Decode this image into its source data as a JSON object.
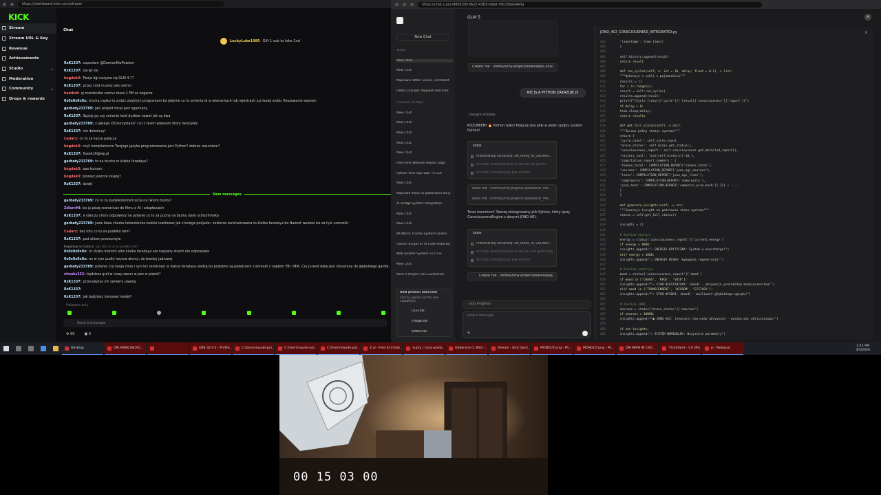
{
  "kick": {
    "url": "https://dashboard.kick.com/stream",
    "logo": "KICK",
    "nav": [
      {
        "label": "Stream",
        "active": true,
        "chevron": false
      },
      {
        "label": "Stream URL & Key",
        "active": false,
        "chevron": false
      },
      {
        "label": "Revenue",
        "active": false,
        "chevron": false
      },
      {
        "label": "Achievements",
        "active": false,
        "chevron": false
      },
      {
        "label": "Studio",
        "active": false,
        "chevron": true
      },
      {
        "label": "Moderation",
        "active": false,
        "chevron": false
      },
      {
        "label": "Community",
        "active": false,
        "chevron": true
      },
      {
        "label": "Drops & rewards",
        "active": false,
        "chevron": false
      }
    ],
    "chat_title": "Chat",
    "pinned_user": "LuckyLuke1980",
    "pinned_text": "Gift 1 sub to take 2nd",
    "messages": [
      {
        "user": "RzK1337:",
        "color": "#bfe4ff",
        "text": "zapoolem @DamianNiePowiem"
      },
      {
        "user": "RzK1337:",
        "color": "#bfe4ff",
        "text": "zacięł sie"
      },
      {
        "user": "bogdek3:",
        "color": "#ff6b6b",
        "text": "Twoja Agi nazywa się GLM 4.7?"
      },
      {
        "user": "RzK1337:",
        "color": "#bfe4ff",
        "text": "przez cmd musisz jako admin"
      },
      {
        "user": "hambot:",
        "color": "#ff6b6b",
        "text": "ej mordeczko czemu masz 2 PM za zegarze"
      },
      {
        "user": "0x0x0x0x0x:",
        "color": "#bfe4ff",
        "text": "trochę ciężko to zrobić zwykłym programem bo jedynie co to zmienia id w elementach lub rejestrach juz lepiej zrobic fleszowanie eeprom"
      },
      {
        "user": "garbaty213769:",
        "color": "#bfe4ff",
        "text": "jaki projekt teraz jest ogarniany"
      },
      {
        "user": "RzK1337:",
        "color": "#bfe4ff",
        "text": "Spytaj go czy zmienia heid dysków nawet jak są dwa"
      },
      {
        "user": "garbaty213769:",
        "color": "#bfe4ff",
        "text": "z jakiego OS korzystasz? i co z tesim własnym który tworzyłeś"
      },
      {
        "user": "RzK1337:",
        "color": "#bfe4ff",
        "text": "nie dokończy!"
      },
      {
        "user": "Cadarz:",
        "color": "#ff6b6b",
        "text": "co to za kasza palacza"
      },
      {
        "user": "bogdek3:",
        "color": "#ff6b6b",
        "text": "czyli kompilatorem Twojego języka programowania jest Python? dobrze rozumiem?"
      },
      {
        "user": "RzK1337:",
        "color": "#bfe4ff",
        "text": "fiseek16@wp.pl"
      },
      {
        "user": "garbaty213769:",
        "color": "#bfe4ff",
        "text": "to na biurku to klatka faradaya?"
      },
      {
        "user": "bogdek3:",
        "color": "#ff6b6b",
        "text": "aaa kumam"
      },
      {
        "user": "bogdek3:",
        "color": "#ff6b6b",
        "text": "piszesz jeszcze książę?"
      },
      {
        "user": "RzK1337:",
        "color": "#bfe4ff",
        "text": "dzięki"
      },
      {
        "user": "garbaty213769:",
        "color": "#bfe4ff",
        "text": "co to za pudełko/konstrukcja na twoim biurku?"
      },
      {
        "user": "ZdlanrNi:",
        "color": "#c58cff",
        "text": "bo ja piszę scenariusz do filmu o AI i adaptacjach"
      },
      {
        "user": "RzK1337:",
        "color": "#bfe4ff",
        "text": "a starczu chory odpowiesz na pytanie co to za pucha na biurku obok schizofrenika"
      },
      {
        "user": "garbaty213769:",
        "color": "#bfe4ff",
        "text": "juwe biała charka holenderska bedzie lewitowac jak z kolega podjade i zostanie zarekwirowana ta klatka faradaya bo Nawrot wezwał sie za tylo uszczelki"
      },
      {
        "user": "Cadarz:",
        "color": "#ff6b6b",
        "text": "bez kitu co to za pudełko tam?"
      },
      {
        "user": "RzK1337:",
        "color": "#bfe4ff",
        "text": "pod okiem przesunięte"
      },
      {
        "user": "Replying to Cadarz:",
        "color": "#777",
        "text": "bez kitu co to za pudełko tam?"
      },
      {
        "user": "0x0x0x0x0x:",
        "color": "#bfe4ff",
        "text": "to chyba monolit albo klatka faradaya ale nacpany starch nie odpowiada"
      },
      {
        "user": "0x0x0x0x0x:",
        "color": "#bfe4ff",
        "text": "on w tym pudle trzyma atomy, do bomby jadrowej"
      },
      {
        "user": "garbaty213769:",
        "color": "#bfe4ff",
        "text": "pytanie czy twoja żona i syn też zamknięci w klatce faradaya siedzą bo podobno są podejrzani o kontakt z rządem FBI i MI6. Czy jurand dalej jest zmuszony do głębokiego gardła?"
      },
      {
        "user": "olmaks232:",
        "color": "#c58cff",
        "text": "będziesz grał w nowy sezon w poe w piątek?"
      },
      {
        "user": "RzK1337:",
        "color": "#bfe4ff",
        "text": "przecialyżas ich serwery uważaj"
      },
      {
        "user": "RzK1337:",
        "color": "#bfe4ff",
        "text": ""
      },
      {
        "user": "RzK1337:",
        "color": "#bfe4ff",
        "text": "jak będziesz trenował model?"
      }
    ],
    "new_messages_label": "New messages",
    "followers_only": "Followers only",
    "send_placeholder": "Send a message",
    "bottom_left": "00",
    "bottom_right": "0"
  },
  "zai": {
    "url": "https://chat.z.ai/c/96622df-0622-4381-bda0-78cd3beb4e0a",
    "model": "GLM 5",
    "new_chat": "New Chat",
    "history": [
      {
        "label": "Today",
        "head": true
      },
      {
        "label": "New Chat",
        "sel": true
      },
      {
        "label": "New Chat"
      },
      {
        "label": "Naprawa HWID: Scena i Architekt"
      },
      {
        "label": "HWID Changer Request Declined"
      },
      {
        "label": "Previous 30 days",
        "head": true
      },
      {
        "label": "New Chat"
      },
      {
        "label": "New Chat"
      },
      {
        "label": "New Chat"
      },
      {
        "label": "New Chat"
      },
      {
        "label": "New Chat"
      },
      {
        "label": "Real-time Website Repair Logic"
      },
      {
        "label": "Python OCR App with Tk GUI"
      },
      {
        "label": "New Chat"
      },
      {
        "label": "Naprawa błędu w pobieraniu okny"
      },
      {
        "label": "AI Bridge System Integration"
      },
      {
        "label": "New Chat"
      },
      {
        "label": "New Chat"
      },
      {
        "label": "MONOLIT Fractal System Global"
      },
      {
        "label": "Python Script for AI Code Refactor"
      },
      {
        "label": "Web Builder System v1.0 Fix"
      },
      {
        "label": "New Chat"
      },
      {
        "label": "Nech z Project Gen Guidelines"
      }
    ],
    "promo_title": "New product launched",
    "promo_text": "Click to explore and try new capabilities",
    "promo_items": [
      "OCR.zai",
      "image.zai",
      "slides.zai"
    ],
    "user_message": "NIE JS A PYTHON ZAKAZUJE JS",
    "thought": "Thought Process",
    "reply1": "ROZUMIEM! 🔥 Python tylko! Połączę oba pliki w jeden spójny system Python!",
    "todos_label": "Todos",
    "todos1": [
      "Przeanalizuj strukturę OM_MAIN_IN_CROWN...",
      "Wczytaj wszystkie pliki JONO AGI w govmi...",
      "Wczytaj integracyjny plik Python"
    ],
    "read_file1": "Read File · /home/z/my-project/upload/OM_MA...",
    "read_file2": "Read File · /home/z/my-project/upload/OM_MA...",
    "reply2": "Teraz rozumiem! Tworzę zintegrowany plik Python, który łączy ConsciousnessEngine z danymi JONO AGI:",
    "todos2": [
      "Przeanalizuj strukturę OM_MAIN_IN_CROWN...",
      "Wczytaj wszystkie pliki JONO AGI do głównego...",
      "Wczytaj integracyjny plik Python"
    ],
    "create_file_top": "Create File · /home/z/my-project/download/Consc...",
    "create_file": "Create File · /home/z/my-project/download/JO...",
    "todo_progress": "Todo Progress",
    "input_placeholder": "Send a Message",
    "code_file": "JONO_AGI_CONSCIOUSNESS_INTEGRATED.py",
    "code_lines": [
      {
        "n": "602",
        "t": "            'timestamp': time.time()"
      },
      {
        "n": "603",
        "t": "        }"
      },
      {
        "n": "604",
        "t": ""
      },
      {
        "n": "605",
        "t": "        self.history.append(result)"
      },
      {
        "n": "606",
        "t": "        return result"
      },
      {
        "n": "607",
        "t": ""
      },
      {
        "n": "608",
        "t": "    def run_cycles(self, n: int = 10, delay: float = 0.1) -> list:"
      },
      {
        "n": "609",
        "t": "        \"\"\"Wykonuje n cykli z pojemnościa\"\"\""
      },
      {
        "n": "610",
        "t": "        results = []"
      },
      {
        "n": "611",
        "t": "        for i in range(n):"
      },
      {
        "n": "612",
        "t": "            result = self.run_cycle()"
      },
      {
        "n": "613",
        "t": "            results.append(result)"
      },
      {
        "n": "614",
        "t": "            print(f\"[Cycle {result['cycle']}] {result['consciousness']['report']}\")"
      },
      {
        "n": "615",
        "t": "            if delay > 0:"
      },
      {
        "n": "616",
        "t": "                time.sleep(delay)"
      },
      {
        "n": "617",
        "t": "        return results"
      },
      {
        "n": "618",
        "t": ""
      },
      {
        "n": "619",
        "t": "    def get_full_status(self) -> dict:"
      },
      {
        "n": "620",
        "t": "        \"\"\"Zwraca pełny status systemu\"\"\""
      },
      {
        "n": "621",
        "t": "        return {"
      },
      {
        "n": "622",
        "t": "            'cycle_count': self.cycle_count,"
      },
      {
        "n": "623",
        "t": "            'brain_status': self.brain.get_status(),"
      },
      {
        "n": "624",
        "t": "            'consciousness_report': self.consciousness.get_detailed_report(),"
      },
      {
        "n": "625",
        "t": "            'history_tail': list(self.history)[-10:],"
      },
      {
        "n": "626",
        "t": "            'compilation_report_summary': {"
      },
      {
        "n": "627",
        "t": "                'tokens_total': COMPILATION_REPORT['tokens_total'],"
      },
      {
        "n": "628",
        "t": "                'neurons': COMPILATION_REPORT['jono_agi_neurons'],"
      },
      {
        "n": "629",
        "t": "                'lines': COMPILATION_REPORT['jono_agi_lines'],"
      },
      {
        "n": "630",
        "t": "                'complexity': COMPILATION_REPORT['complexity'],"
      },
      {
        "n": "631",
        "t": "                'plan_hash': COMPILATION_REPORT['semantic_plan_hash'][:32] + '...'"
      },
      {
        "n": "632",
        "t": "            }"
      },
      {
        "n": "633",
        "t": "        }"
      },
      {
        "n": "634",
        "t": ""
      },
      {
        "n": "635",
        "t": "    def generate_insights(self) -> str:"
      },
      {
        "n": "636",
        "t": "        \"\"\"Generuje insight na podstawie stanu systemu\"\"\""
      },
      {
        "n": "637",
        "t": "        status = self.get_full_status()"
      },
      {
        "n": "638",
        "t": ""
      },
      {
        "n": "639",
        "t": "        insights = []"
      },
      {
        "n": "640",
        "t": ""
      },
      {
        "n": "641",
        "t": "        # Analiza energii"
      },
      {
        "n": "642",
        "t": "        energy = status['consciousness_report']['current_energy']"
      },
      {
        "n": "643",
        "t": "        if energy > 8000:"
      },
      {
        "n": "644",
        "t": "            insights.append(\"⚡ ENERGIA KRYTYCZNA: System w overcharge!\")"
      },
      {
        "n": "645",
        "t": "        elif energy < 1000:"
      },
      {
        "n": "646",
        "t": "            insights.append(\"⚠ ENERGIA NISKA: Wymagana regeneracja!\")"
      },
      {
        "n": "647",
        "t": ""
      },
      {
        "n": "648",
        "t": "        # Analiza nastroju"
      },
      {
        "n": "649",
        "t": "        mood = status['consciousness_report']['mood']"
      },
      {
        "n": "650",
        "t": "        if mood in ['CHAOS', 'RAGE', 'VOID']:"
      },
      {
        "n": "651",
        "t": "            insights.append(f\"⚠ STAN NIESTABILNY: {mood} - aktywacja protokołów bezpieczeństwa!\")"
      },
      {
        "n": "652",
        "t": "        elif mood in ['TRANSCENDENT', 'WISDOM', 'ECSTASY']:"
      },
      {
        "n": "653",
        "t": "            insights.append(f\"✦ STAN WYSOKI: {mood} - możliwość głębokiego wglądu!\")"
      },
      {
        "n": "654",
        "t": ""
      },
      {
        "n": "655",
        "t": "        # Analiza JONO"
      },
      {
        "n": "656",
        "t": "        neurons = status['brain_status']['neurons']"
      },
      {
        "n": "657",
        "t": "        if neurons > 10000:"
      },
      {
        "n": "658",
        "t": "            insights.append(f\"● JONO AGI: {neurons} neuronów aktywnych - wysoka moc obliczeniowa!\")"
      },
      {
        "n": "659",
        "t": ""
      },
      {
        "n": "660",
        "t": "        if not insights:"
      },
      {
        "n": "661",
        "t": "            insights.append(\"✓ SYSTEM NOMINALNY: Wszystkie parametry\")"
      }
    ]
  },
  "taskbar": {
    "items": [
      {
        "label": "Desktop",
        "red": false
      },
      {
        "label": "OM_MAIN_INCRO...",
        "red": true
      },
      {
        "label": "",
        "red": true
      },
      {
        "label": "OBS 32.0.4 - Profile...",
        "red": true
      },
      {
        "label": "C:\\Users\\noude-pol...",
        "red": true
      },
      {
        "label": "C:\\Users\\noude-pol...",
        "red": true
      },
      {
        "label": "C:\\Users\\noude-pol...",
        "red": true
      },
      {
        "label": "Z.ai - Free AI Chatb...",
        "red": true
      },
      {
        "label": "1upty | Lista wiado...",
        "red": true
      },
      {
        "label": "Odebrane (1 802) -...",
        "red": true
      },
      {
        "label": "Stream - Kick Dash...",
        "red": true
      },
      {
        "label": "MONOLIT.png - Ph...",
        "red": true
      },
      {
        "label": "MONOLIT.png - Ph...",
        "red": true
      },
      {
        "label": "OM MAIN IN CRO...",
        "red": true
      },
      {
        "label": "*(Untitled) - 1.0 (RG...",
        "red": true
      },
      {
        "label": "js - Notepad",
        "red": true
      }
    ],
    "time": "3:11 PM",
    "date": "3/5/2026",
    "lang": "ENG PLP"
  },
  "camera": {
    "timer": "00 15 03 00"
  }
}
